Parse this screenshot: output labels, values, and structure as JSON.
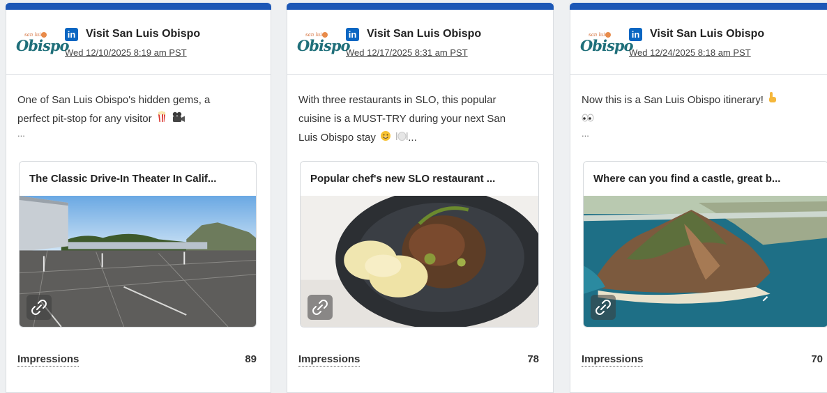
{
  "cards": [
    {
      "account": "Visit San Luis Obispo",
      "date": "Wed 12/10/2025 8:19 am PST",
      "post_line1": "One of San Luis Obispo's hidden gems, a",
      "post_line2": "perfect pit-stop for any visitor",
      "post_more": "...",
      "preview_title": "The Classic Drive-In Theater In Calif...",
      "impressions_label": "Impressions",
      "impressions": "89"
    },
    {
      "account": "Visit San Luis Obispo",
      "date": "Wed 12/17/2025 8:31 am PST",
      "post_line1": "With three restaurants in SLO, this popular",
      "post_line2": "cuisine is a MUST-TRY during your next San",
      "post_line3": "Luis Obispo stay",
      "post_more": "...",
      "preview_title": "Popular chef's new SLO restaurant ...",
      "impressions_label": "Impressions",
      "impressions": "78"
    },
    {
      "account": "Visit San Luis Obispo",
      "date": "Wed 12/24/2025 8:18 am PST",
      "post_line1": "Now this is a San Luis Obispo itinerary!",
      "post_more": "...",
      "preview_title": "Where can you find a castle, great b...",
      "impressions_label": "Impressions",
      "impressions": "70"
    }
  ],
  "logo": {
    "small": "san luis",
    "big": "Obispo"
  },
  "linkedin_badge": "in",
  "icons": [
    "linkedin-icon",
    "popcorn-icon",
    "movie-camera-icon",
    "smile-icon",
    "plate-icon",
    "pointing-down-icon",
    "eyes-icon",
    "link-icon"
  ],
  "colors": {
    "accent_bar": "#1c57b6",
    "linkedin": "#0a66c2"
  }
}
